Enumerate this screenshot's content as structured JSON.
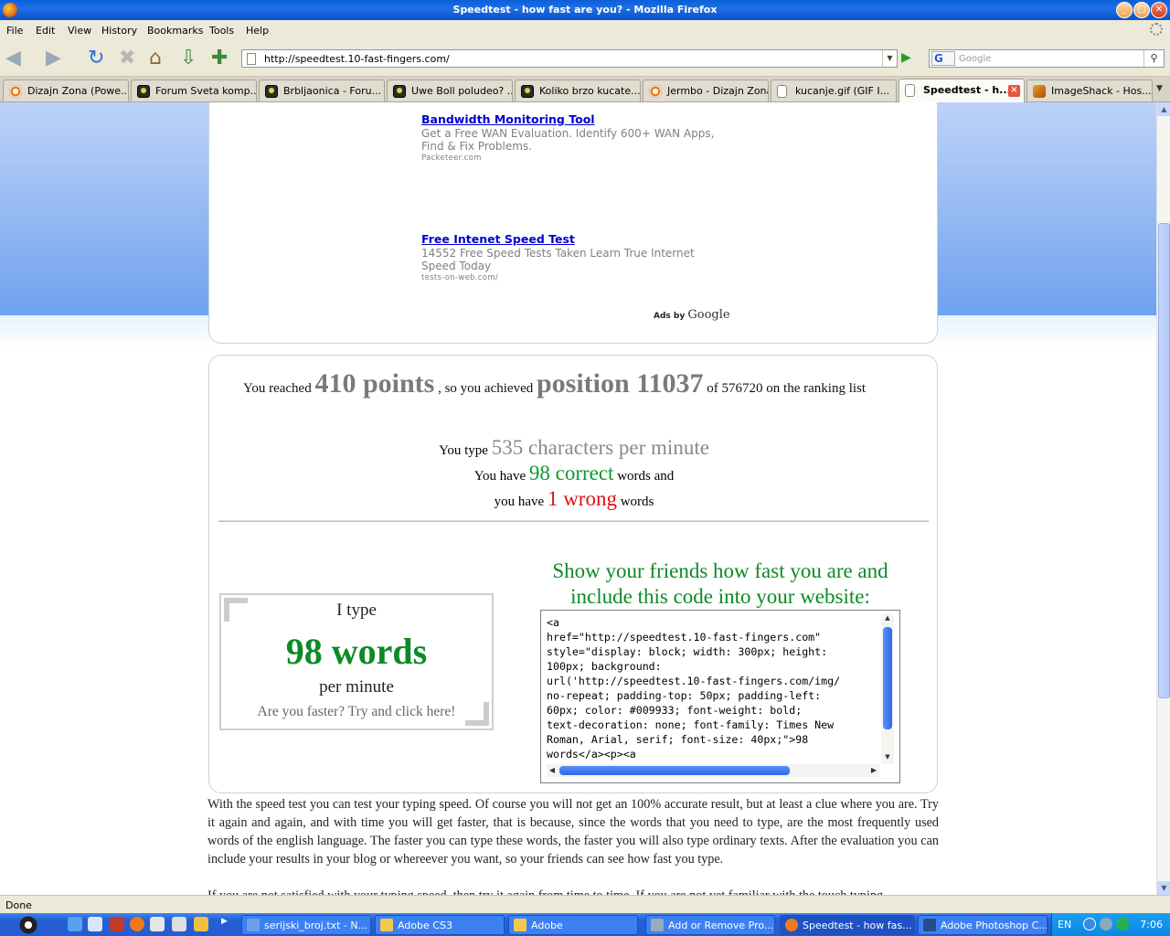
{
  "window": {
    "title": "Speedtest - how fast are you? - Mozilla Firefox",
    "controls": {
      "minimize": "_",
      "maximize": "□",
      "close": "✕"
    }
  },
  "menu": [
    "File",
    "Edit",
    "View",
    "History",
    "Bookmarks",
    "Tools",
    "Help"
  ],
  "toolbar": {
    "back_icon": "back-arrow-icon",
    "forward_icon": "forward-arrow-icon",
    "url": "http://speedtest.10-fast-fingers.com/",
    "search_engine": "G",
    "search_placeholder": "Google"
  },
  "tabs": [
    {
      "label": "Dizajn Zona (Powe...",
      "icon": "orange"
    },
    {
      "label": "Forum Sveta komp...",
      "icon": "trafficlight"
    },
    {
      "label": "Brbljaonica - Foru...",
      "icon": "trafficlight"
    },
    {
      "label": "Uwe Boll poludeo? ...",
      "icon": "trafficlight"
    },
    {
      "label": "Koliko brzo kucate...",
      "icon": "trafficlight"
    },
    {
      "label": "Jermbo - Dizajn Zona",
      "icon": "orange"
    },
    {
      "label": "kucanje.gif (GIF I...",
      "icon": "doc"
    },
    {
      "label": "Speedtest - h...",
      "icon": "doc",
      "active": true
    },
    {
      "label": "ImageShack - Hos...",
      "icon": "shack"
    }
  ],
  "ads": [
    {
      "title": "Bandwidth Monitoring Tool",
      "desc": "Get a Free WAN Evaluation. Identify 600+ WAN Apps, Find & Fix Problems.",
      "url": "Packeteer.com"
    },
    {
      "title": "Free Intenet Speed Test",
      "desc": "14552 Free Speed Tests Taken Learn True Internet Speed Today",
      "url": "tests-on-web.com/"
    }
  ],
  "ads_by": {
    "prefix": "Ads by",
    "brand": "Google"
  },
  "result": {
    "reached_prefix": "You reached",
    "points": "410 points",
    "achieved_text": ", so you achieved",
    "position": "position 11037",
    "ranking_text": "of 576720 on the ranking list",
    "type_prefix": "You type",
    "cpm": "535 characters per minute",
    "have_prefix": "You have",
    "correct": "98 correct",
    "correct_suffix": "words and",
    "you_have": "you have",
    "wrong": "1 wrong",
    "wrong_suffix": "words"
  },
  "badge": {
    "i_type": "I type",
    "words": "98 words",
    "per_minute": "per minute",
    "faster": "Are you faster? Try and click here!"
  },
  "share": {
    "heading": "Show your friends how fast you are and include this code into your website:",
    "code": "<a\nhref=\"http://speedtest.10-fast-fingers.com\"\nstyle=\"display: block; width: 300px; height:\n100px; background:\nurl('http://speedtest.10-fast-fingers.com/img/\nno-repeat; padding-top: 50px; padding-left:\n60px; color: #009933; font-weight: bold;\ntext-decoration: none; font-family: Times New\nRoman, Arial, serif; font-size: 40px;\">98\nwords</a><p><a"
  },
  "paragraph": "With the speed test you can test your typing speed. Of course you will not get an 100% accurate result, but at least a clue where you are. Try it again and again, and with time you will get faster, that is because, since the words that you need to type, are the most frequently used words of the english language. The faster you can type these words, the faster you will also type ordinary texts. After the evaluation you can include your results in your blog or whereever you want, so your friends can see how fast you type.",
  "paragraph2": "If you are not satisfied with your typing speed, then try it again from time to time. If you are not yet familiar with the touch typing",
  "status": "Done",
  "taskbar": {
    "buttons": [
      {
        "label": "serijski_broj.txt - N...",
        "color": "#6aa0e8"
      },
      {
        "label": "Adobe CS3",
        "color": "#f2c94c"
      },
      {
        "label": "Adobe",
        "color": "#f2c94c"
      },
      {
        "label": "Add or Remove Pro...",
        "color": "#9ab"
      },
      {
        "label": "Speedtest - how fas...",
        "color": "#f07a1a",
        "active": true
      },
      {
        "label": "Adobe Photoshop C...",
        "color": "#2a4a8a"
      }
    ],
    "lang": "EN",
    "clock": "7:06"
  },
  "colors": {
    "accent_green": "#0c9a2a",
    "wrong_red": "#e01010",
    "link_blue": "#0000cc"
  }
}
